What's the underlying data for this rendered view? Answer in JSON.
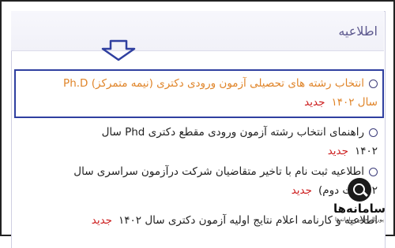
{
  "panel": {
    "title": "اطلاعیه"
  },
  "icons": {
    "arrow": "down-arrow-icon",
    "bullet": "circle-bullet-icon",
    "watermark": "magnifier-icon"
  },
  "colors": {
    "highlight_text": "#e0852a",
    "new_badge": "#cc1b1b",
    "highlight_border": "#2f3fa0",
    "arrow": "#2f3fa0"
  },
  "news": [
    {
      "lines": [
        "انتخاب رشته های تحصیلی آزمون ورودی دکتری (نیمه متمرکز) Ph.D",
        "سال ۱۴۰۲"
      ],
      "badge": "جدید",
      "highlighted": true
    },
    {
      "lines": [
        "راهنمای انتخاب رشته آزمون ورودی مقطع دکتری Phd سال",
        "۱۴۰۲"
      ],
      "badge": "جدید",
      "highlighted": false
    },
    {
      "lines": [
        "اطلاعیه ثبت نام با تاخیر متقاضیان شرکت درآزمون سراسری سال",
        "۲ (نوبت دوم)"
      ],
      "badge": "جدید",
      "highlighted": false
    },
    {
      "lines": [
        "اطلاعیه و کارنامه اعلام نتایج اولیه آزمون دکتری سال ۱۴۰۲"
      ],
      "badge": "جدید",
      "highlighted": false
    }
  ],
  "watermark": {
    "title": "سامانه‌ها",
    "subtitle": "پورتال جامع سامانه‌ها"
  }
}
